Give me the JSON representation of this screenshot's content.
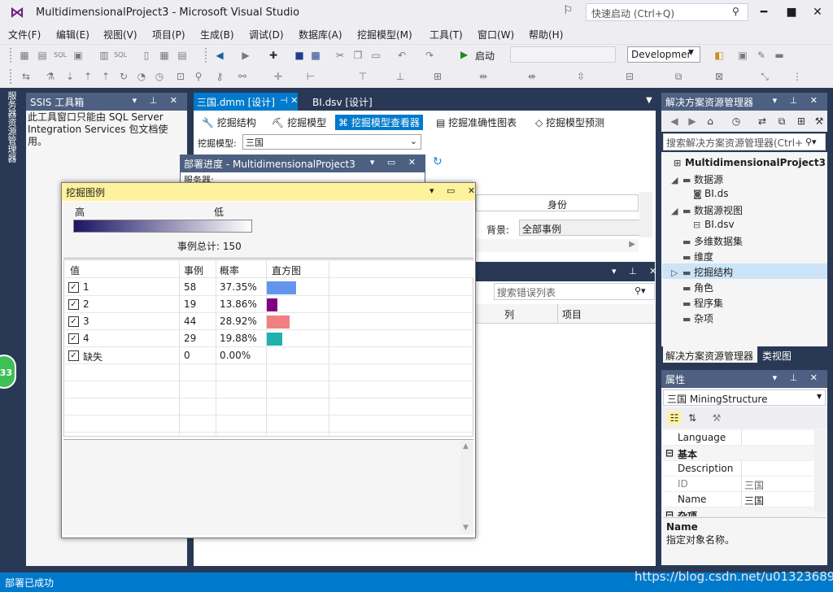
{
  "window": {
    "title": "MultidimensionalProject3 - Microsoft Visual Studio",
    "quick_launch_placeholder": "快速启动 (Ctrl+Q)"
  },
  "menu": [
    "文件(F)",
    "编辑(E)",
    "视图(V)",
    "项目(P)",
    "生成(B)",
    "调试(D)",
    "数据库(A)",
    "挖掘模型(M)",
    "工具(T)",
    "窗口(W)",
    "帮助(H)"
  ],
  "toolbar": {
    "start_label": "启动",
    "config_value": "Developmer"
  },
  "left_tab": {
    "label": "服务器资源管理器",
    "badge": "33"
  },
  "ssis_toolbox": {
    "title": "SSIS 工具箱",
    "message": "此工具窗口只能由 SQL Server Integration Services 包文档使用。"
  },
  "doc_tabs": [
    {
      "label": "三国.dmm [设计]",
      "active": true
    },
    {
      "label": "BI.dsv [设计]",
      "active": false
    }
  ],
  "sub_tabs": [
    {
      "label": "挖掘结构",
      "icon": "wrench-icon"
    },
    {
      "label": "挖掘模型",
      "icon": "pickaxe-icon"
    },
    {
      "label": "挖掘模型查看器",
      "icon": "tree-icon",
      "selected": true
    },
    {
      "label": "挖掘准确性图表",
      "icon": "chart-icon"
    },
    {
      "label": "挖掘模型预测",
      "icon": "diamond-icon"
    }
  ],
  "model": {
    "label": "挖掘模型:",
    "value": "三国"
  },
  "viewer": {
    "identity_header": "身份",
    "background_label": "背景:",
    "background_value": "全部事例"
  },
  "error_list": {
    "search_placeholder": "搜索错误列表",
    "cols": [
      "列",
      "项目"
    ]
  },
  "deploy": {
    "title": "部署进度 - MultidimensionalProject3",
    "server_label": "服务器:"
  },
  "legend": {
    "title": "挖掘图例",
    "high": "高",
    "low": "低",
    "case_total": "事例总计:  150",
    "columns": [
      "值",
      "事例",
      "概率",
      "直方图"
    ],
    "rows": [
      {
        "value": "1",
        "cases": "58",
        "prob": "37.35%",
        "bar": 0.3735,
        "color": "#6495ed"
      },
      {
        "value": "2",
        "cases": "19",
        "prob": "13.86%",
        "bar": 0.1386,
        "color": "#800080"
      },
      {
        "value": "3",
        "cases": "44",
        "prob": "28.92%",
        "bar": 0.2892,
        "color": "#f08080"
      },
      {
        "value": "4",
        "cases": "29",
        "prob": "19.88%",
        "bar": 0.1988,
        "color": "#20b2aa"
      },
      {
        "value": "缺失",
        "cases": "0",
        "prob": "0.00%",
        "bar": 0,
        "color": "#cccccc"
      }
    ]
  },
  "solution": {
    "title": "解决方案资源管理器",
    "search_placeholder": "搜索解决方案资源管理器(Ctrl+",
    "project": "MultidimensionalProject3",
    "items": [
      {
        "label": "数据源",
        "level": 1,
        "expand": "◢"
      },
      {
        "label": "BI.ds",
        "level": 2,
        "expand": ""
      },
      {
        "label": "数据源视图",
        "level": 1,
        "expand": "◢"
      },
      {
        "label": "BI.dsv",
        "level": 2,
        "expand": ""
      },
      {
        "label": "多维数据集",
        "level": 1,
        "expand": ""
      },
      {
        "label": "维度",
        "level": 1,
        "expand": ""
      },
      {
        "label": "挖掘结构",
        "level": 1,
        "expand": "▷"
      },
      {
        "label": "角色",
        "level": 1,
        "expand": ""
      },
      {
        "label": "程序集",
        "level": 1,
        "expand": ""
      },
      {
        "label": "杂项",
        "level": 1,
        "expand": ""
      }
    ],
    "tab_active": "解决方案资源管理器",
    "tab_other": "类视图"
  },
  "properties": {
    "title": "属性",
    "object": "三国  MiningStructure",
    "rows": [
      {
        "key": "Language",
        "value": "",
        "cat": false
      },
      {
        "key": "基本",
        "value": "",
        "cat": true
      },
      {
        "key": "Description",
        "value": "",
        "cat": false
      },
      {
        "key": "ID",
        "value": "三国",
        "cat": false
      },
      {
        "key": "Name",
        "value": "三国",
        "cat": false
      },
      {
        "key": "杂项",
        "value": "",
        "cat": true
      }
    ],
    "desc_title": "Name",
    "desc_text": "指定对象名称。"
  },
  "status": {
    "text": "部署已成功",
    "watermark": "https://blog.csdn.net/u013236891"
  }
}
